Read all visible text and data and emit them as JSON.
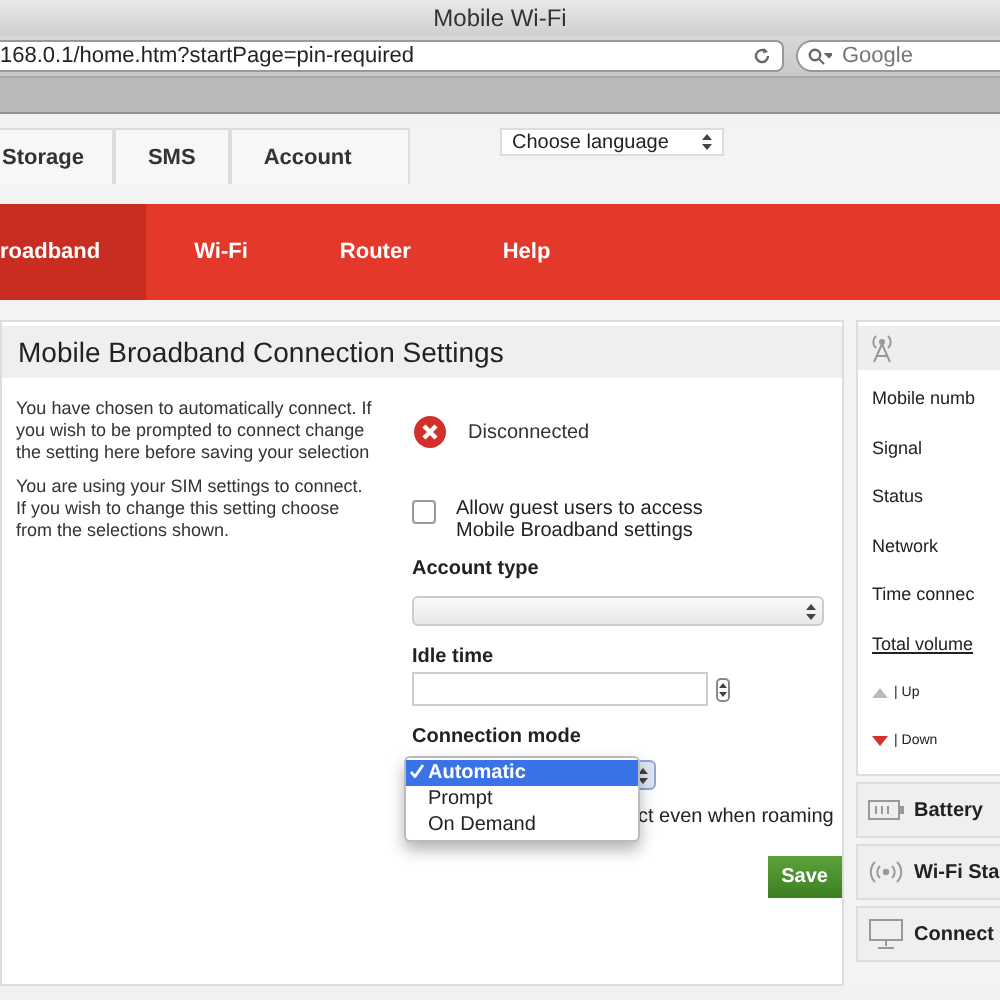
{
  "window": {
    "title": "Mobile Wi-Fi"
  },
  "address_bar": {
    "url": "168.0.1/home.htm?startPage=pin-required"
  },
  "search": {
    "placeholder": "Google"
  },
  "top_tabs": [
    {
      "label": "Storage"
    },
    {
      "label": "SMS"
    },
    {
      "label": "Account"
    }
  ],
  "language_select": {
    "value": "Choose language"
  },
  "nav": [
    {
      "label": "roadband",
      "selected": true
    },
    {
      "label": "Wi-Fi",
      "selected": false
    },
    {
      "label": "Router",
      "selected": false
    },
    {
      "label": "Help",
      "selected": false
    }
  ],
  "panel": {
    "title": "Mobile Broadband Connection Settings",
    "paragraphs": [
      "You have chosen to automatically connect. If you wish to be prompted to connect change the setting here before saving your selection",
      "You are using your SIM settings to connect. If you wish to change this setting choose from the selections shown."
    ],
    "status": {
      "text": "Disconnected",
      "connected": false
    },
    "guest_access": {
      "label": "Allow guest users to access Mobile Broadband settings",
      "checked": false
    },
    "account_type": {
      "label": "Account type"
    },
    "idle_time": {
      "label": "Idle time"
    },
    "connection_mode": {
      "label": "Connection mode",
      "options": [
        {
          "label": "Automatic",
          "selected": true
        },
        {
          "label": "Prompt",
          "selected": false
        },
        {
          "label": "On Demand",
          "selected": false
        }
      ]
    },
    "roaming": {
      "label": "ct even when roaming"
    },
    "save": "Save"
  },
  "side_panel": {
    "rows": [
      {
        "label": "Mobile numb",
        "kind": "text"
      },
      {
        "label": "Signal",
        "kind": "text"
      },
      {
        "label": "Status",
        "kind": "text"
      },
      {
        "label": "Network",
        "kind": "text"
      },
      {
        "label": "Time connec",
        "kind": "text"
      },
      {
        "label": "Total volume",
        "kind": "link"
      },
      {
        "label": "| Up",
        "kind": "up"
      },
      {
        "label": "| Down",
        "kind": "down"
      }
    ],
    "sections": [
      {
        "label": "Battery",
        "kind": "battery"
      },
      {
        "label": "Wi-Fi Sta",
        "kind": "wifi"
      },
      {
        "label": "Connect",
        "kind": "monitor"
      }
    ]
  }
}
